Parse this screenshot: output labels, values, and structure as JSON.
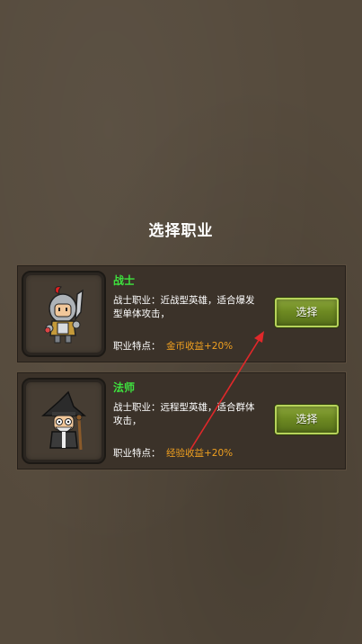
{
  "screen_title": "选择职业",
  "classes": [
    {
      "name": "战士",
      "description": "战士职业：近战型英雄，适合爆发型单体攻击，",
      "trait_label": "职业特点：",
      "trait_value": "金币收益+20%",
      "button_label": "选择",
      "portrait_icon": "warrior-icon"
    },
    {
      "name": "法师",
      "description": "战士职业：远程型英雄，适合群体攻击，",
      "trait_label": "职业特点：",
      "trait_value": "经验收益+20%",
      "button_label": "选择",
      "portrait_icon": "mage-icon"
    }
  ],
  "colors": {
    "class_name": "#3ee23e",
    "trait_value": "#f0a020",
    "button": "#6e8a22",
    "arrow": "#e0282a"
  }
}
